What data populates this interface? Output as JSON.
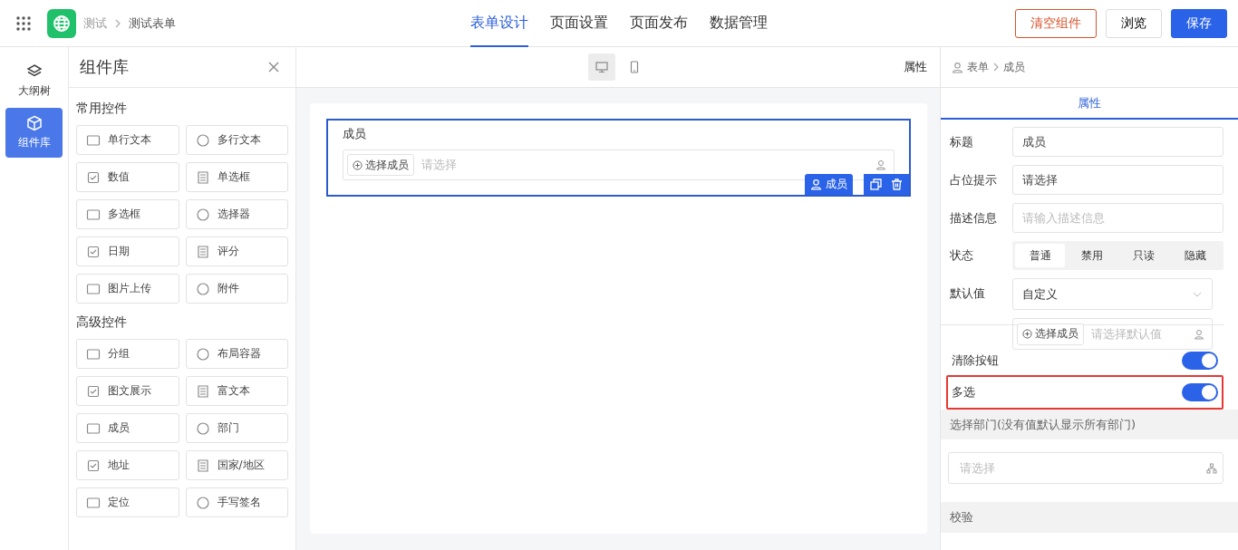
{
  "header": {
    "breadcrumb": [
      "测试",
      "测试表单"
    ],
    "nav": [
      {
        "label": "表单设计",
        "selected": true
      },
      {
        "label": "页面设置",
        "selected": false
      },
      {
        "label": "页面发布",
        "selected": false
      },
      {
        "label": "数据管理",
        "selected": false
      }
    ],
    "buttons": [
      {
        "label": "清空组件",
        "kind": "danger"
      },
      {
        "label": "浏览",
        "kind": "default"
      },
      {
        "label": "保存",
        "kind": "primary"
      }
    ]
  },
  "rail": [
    {
      "label": "大纲树",
      "selected": false
    },
    {
      "label": "组件库",
      "selected": true
    }
  ],
  "library": {
    "title": "组件库",
    "groups": [
      {
        "title": "常用控件",
        "items": [
          "单行文本",
          "多行文本",
          "数值",
          "单选框",
          "多选框",
          "选择器",
          "日期",
          "评分",
          "图片上传",
          "附件"
        ]
      },
      {
        "title": "高级控件",
        "items": [
          "分组",
          "布局容器",
          "图文展示",
          "富文本",
          "成员",
          "部门",
          "地址",
          "国家/地区",
          "定位",
          "手写签名"
        ]
      }
    ]
  },
  "canvas": {
    "devices": [
      {
        "kind": "desktop",
        "selected": true
      },
      {
        "kind": "mobile",
        "selected": false
      }
    ],
    "panel_label": "属性",
    "field": {
      "label": "成员",
      "button": "选择成员",
      "placeholder": "请选择",
      "tag": "成员"
    }
  },
  "props": {
    "breadcrumb": [
      "表单",
      "成员"
    ],
    "tab": "属性",
    "title": {
      "label": "标题",
      "value": "成员"
    },
    "hint": {
      "label": "占位提示",
      "value": "请选择"
    },
    "desc": {
      "label": "描述信息",
      "placeholder": "请输入描述信息"
    },
    "state": {
      "label": "状态",
      "options": [
        {
          "label": "普通",
          "selected": true
        },
        {
          "label": "禁用",
          "selected": false
        },
        {
          "label": "只读",
          "selected": false
        },
        {
          "label": "隐藏",
          "selected": false
        }
      ]
    },
    "default": {
      "label": "默认值",
      "value": "自定义",
      "button": "选择成员",
      "placeholder": "请选择默认值"
    },
    "toggles": [
      {
        "label": "清除按钮",
        "on": true,
        "highlighted": false
      },
      {
        "label": "多选",
        "on": true,
        "highlighted": true
      }
    ],
    "dept": {
      "label": "选择部门(没有值默认显示所有部门)",
      "placeholder": "请选择"
    },
    "section": "校验"
  }
}
